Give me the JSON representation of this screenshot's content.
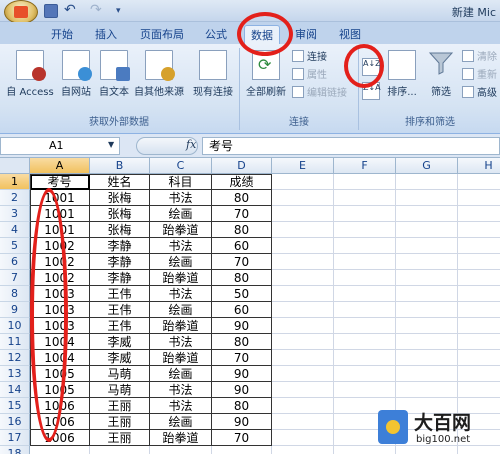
{
  "title_bar": {
    "window_title": "新建 Mic",
    "office_button": "office-button-icon",
    "quick_access": [
      "save-icon",
      "undo-icon",
      "redo-icon",
      "customize-icon"
    ]
  },
  "tabs": [
    {
      "label": "开始"
    },
    {
      "label": "插入"
    },
    {
      "label": "页面布局"
    },
    {
      "label": "公式"
    },
    {
      "label": "数据",
      "active": true
    },
    {
      "label": "审阅"
    },
    {
      "label": "视图"
    }
  ],
  "ribbon": {
    "groups": [
      {
        "label": "获取外部数据",
        "buttons": [
          {
            "label": "自 Access",
            "icon": "access-icon"
          },
          {
            "label": "自网站",
            "icon": "web-icon"
          },
          {
            "label": "自文本",
            "icon": "text-file-icon"
          },
          {
            "label": "自其他来源",
            "icon": "other-sources-icon"
          },
          {
            "label": "现有连接",
            "icon": "existing-connections-icon"
          }
        ]
      },
      {
        "label": "连接",
        "big_button": {
          "label": "全部刷新",
          "icon": "refresh-icon"
        },
        "small_buttons": [
          {
            "label": "连接",
            "enabled": true
          },
          {
            "label": "属性",
            "enabled": false
          },
          {
            "label": "编辑链接",
            "enabled": false
          }
        ]
      },
      {
        "label": "排序和筛选",
        "sort_asc": "A↓Z",
        "sort_desc": "Z↓A",
        "sort_label": "排序...",
        "filter_label": "筛选",
        "small_buttons": [
          {
            "label": "清除",
            "enabled": false
          },
          {
            "label": "重新",
            "enabled": false
          },
          {
            "label": "高级",
            "enabled": true
          }
        ]
      }
    ]
  },
  "formula_bar": {
    "name_box": "A1",
    "fx": "fx",
    "content": "考号"
  },
  "sheet": {
    "columns": [
      "A",
      "B",
      "C",
      "D",
      "E",
      "F",
      "G",
      "H"
    ],
    "selected_column": "A",
    "selected_row": 1,
    "header_row": [
      "考号",
      "姓名",
      "科目",
      "成绩"
    ],
    "rows": [
      [
        "1001",
        "张梅",
        "书法",
        "80"
      ],
      [
        "1001",
        "张梅",
        "绘画",
        "70"
      ],
      [
        "1001",
        "张梅",
        "跆拳道",
        "80"
      ],
      [
        "1002",
        "李静",
        "书法",
        "60"
      ],
      [
        "1002",
        "李静",
        "绘画",
        "70"
      ],
      [
        "1002",
        "李静",
        "跆拳道",
        "80"
      ],
      [
        "1003",
        "王伟",
        "书法",
        "50"
      ],
      [
        "1003",
        "王伟",
        "绘画",
        "60"
      ],
      [
        "1003",
        "王伟",
        "跆拳道",
        "90"
      ],
      [
        "1004",
        "李威",
        "书法",
        "80"
      ],
      [
        "1004",
        "李威",
        "跆拳道",
        "70"
      ],
      [
        "1005",
        "马萌",
        "绘画",
        "90"
      ],
      [
        "1005",
        "马萌",
        "书法",
        "90"
      ],
      [
        "1006",
        "王丽",
        "书法",
        "80"
      ],
      [
        "1006",
        "王丽",
        "绘画",
        "90"
      ],
      [
        "1006",
        "王丽",
        "跆拳道",
        "70"
      ]
    ],
    "row_numbers": [
      "1",
      "2",
      "3",
      "4",
      "5",
      "6",
      "7",
      "8",
      "9",
      "10",
      "11",
      "12",
      "13",
      "14",
      "15",
      "16",
      "17",
      "18"
    ]
  },
  "annotation_color": "#e3201b",
  "watermark": {
    "name": "大百网",
    "url": "big100.net"
  }
}
